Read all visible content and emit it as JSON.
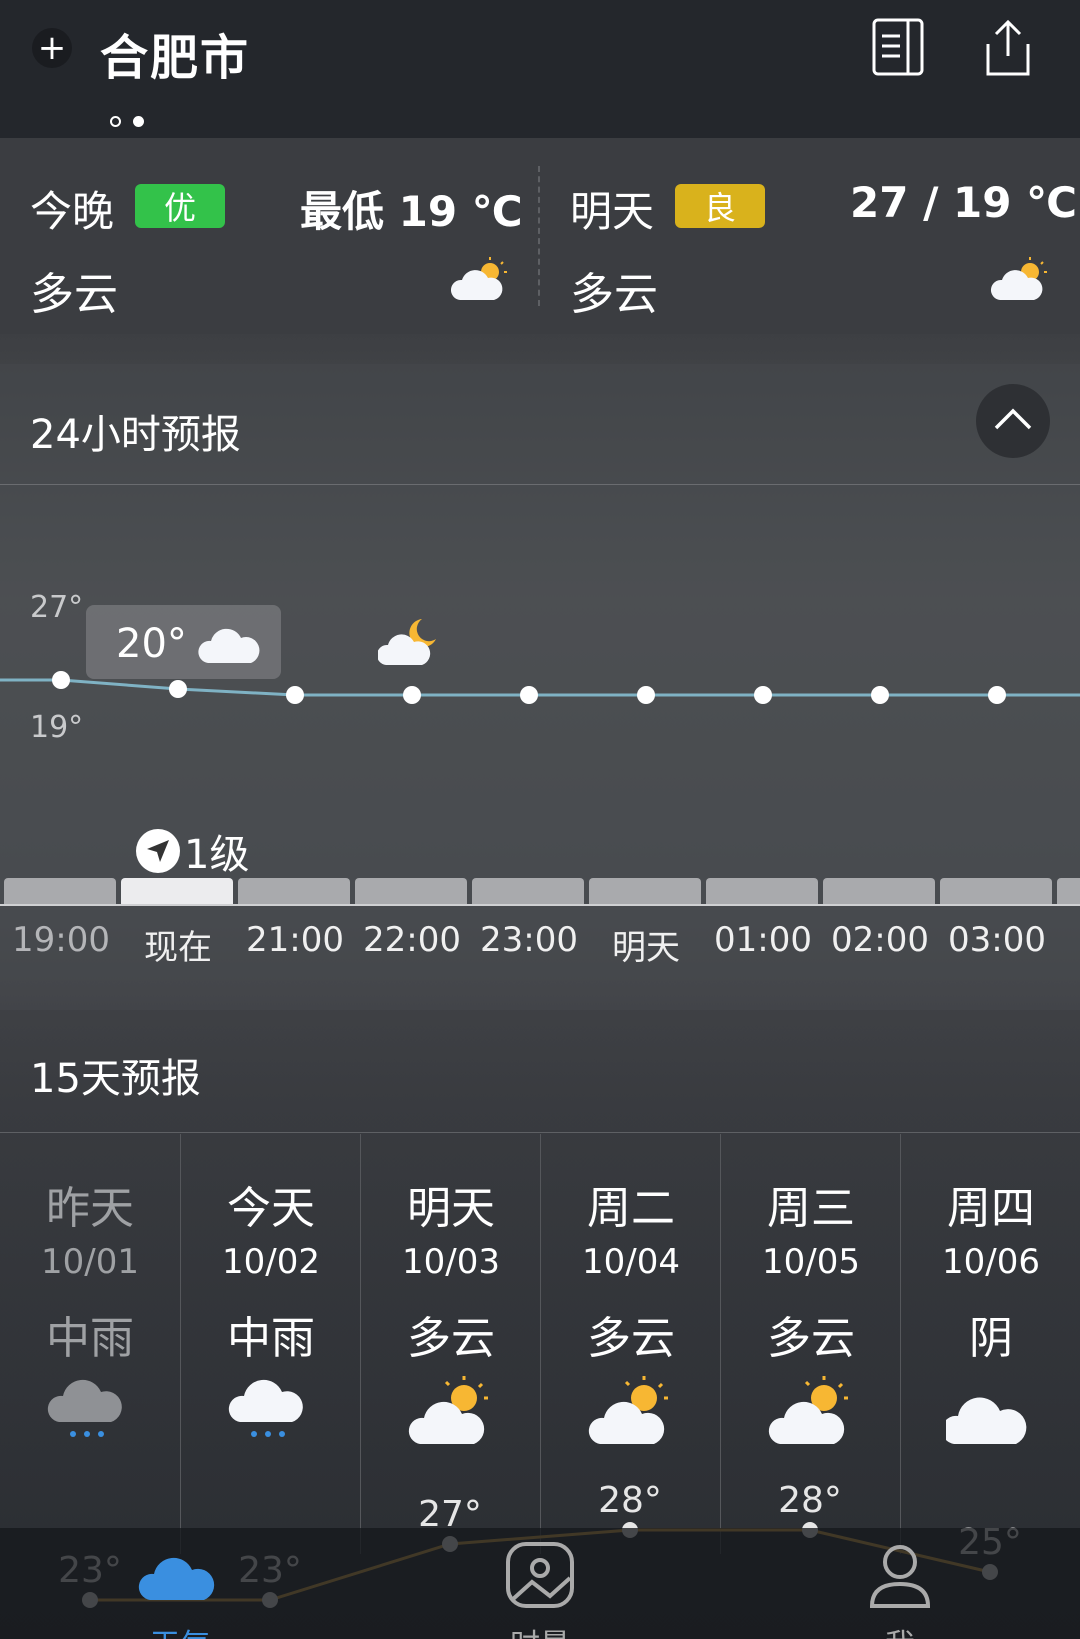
{
  "header": {
    "add_icon": "plus-icon",
    "city": "合肥市",
    "page_dots": 2,
    "active_dot": 1,
    "news_icon": "news-icon",
    "share_icon": "share-icon"
  },
  "summary": {
    "tonight": {
      "day": "今晚",
      "aqi": "优",
      "aqi_color": "#33c24a",
      "temp": "最低 19 ℃",
      "condition": "多云",
      "icon": "partly-cloudy-icon"
    },
    "tomorrow": {
      "day": "明天",
      "aqi": "良",
      "aqi_color": "#d9b21c",
      "temp": "27 / 19 ℃",
      "condition": "多云",
      "icon": "partly-cloudy-icon"
    }
  },
  "hourly": {
    "title": "24小时预报",
    "collapse_icon": "chevron-up-icon",
    "y_top": "27°",
    "y_bottom": "19°",
    "tooltip_temp": "20°",
    "tooltip_icon": "cloud-icon",
    "moon_icon": "moon-cloud-icon",
    "wind": "1级",
    "wind_icon": "wind-direction-icon",
    "line_color": "#7fb2c4",
    "times": [
      "19:00",
      "现在",
      "21:00",
      "22:00",
      "23:00",
      "明天",
      "01:00",
      "02:00",
      "03:00"
    ],
    "temps": [
      19.5,
      19.2,
      19.0,
      19.0,
      19.0,
      19.0,
      19.0,
      19.0,
      19.0
    ]
  },
  "daily": {
    "title": "15天预报",
    "days": [
      {
        "day": "昨天",
        "date": "10/01",
        "condition": "中雨",
        "icon": "rain-icon",
        "high": "23°"
      },
      {
        "day": "今天",
        "date": "10/02",
        "condition": "中雨",
        "icon": "rain-icon",
        "high": "23°"
      },
      {
        "day": "明天",
        "date": "10/03",
        "condition": "多云",
        "icon": "partly-cloudy-icon",
        "high": "27°"
      },
      {
        "day": "周二",
        "date": "10/04",
        "condition": "多云",
        "icon": "partly-cloudy-icon",
        "high": "28°"
      },
      {
        "day": "周三",
        "date": "10/05",
        "condition": "多云",
        "icon": "partly-cloudy-icon",
        "high": "28°"
      },
      {
        "day": "周四",
        "date": "10/06",
        "condition": "阴",
        "icon": "cloud-icon",
        "high": "25°"
      }
    ]
  },
  "nav": {
    "items": [
      {
        "label": "天气",
        "icon": "weather-cloud-icon",
        "active": true
      },
      {
        "label": "时景",
        "icon": "photo-icon",
        "active": false
      },
      {
        "label": "我",
        "icon": "profile-icon",
        "active": false
      }
    ]
  }
}
